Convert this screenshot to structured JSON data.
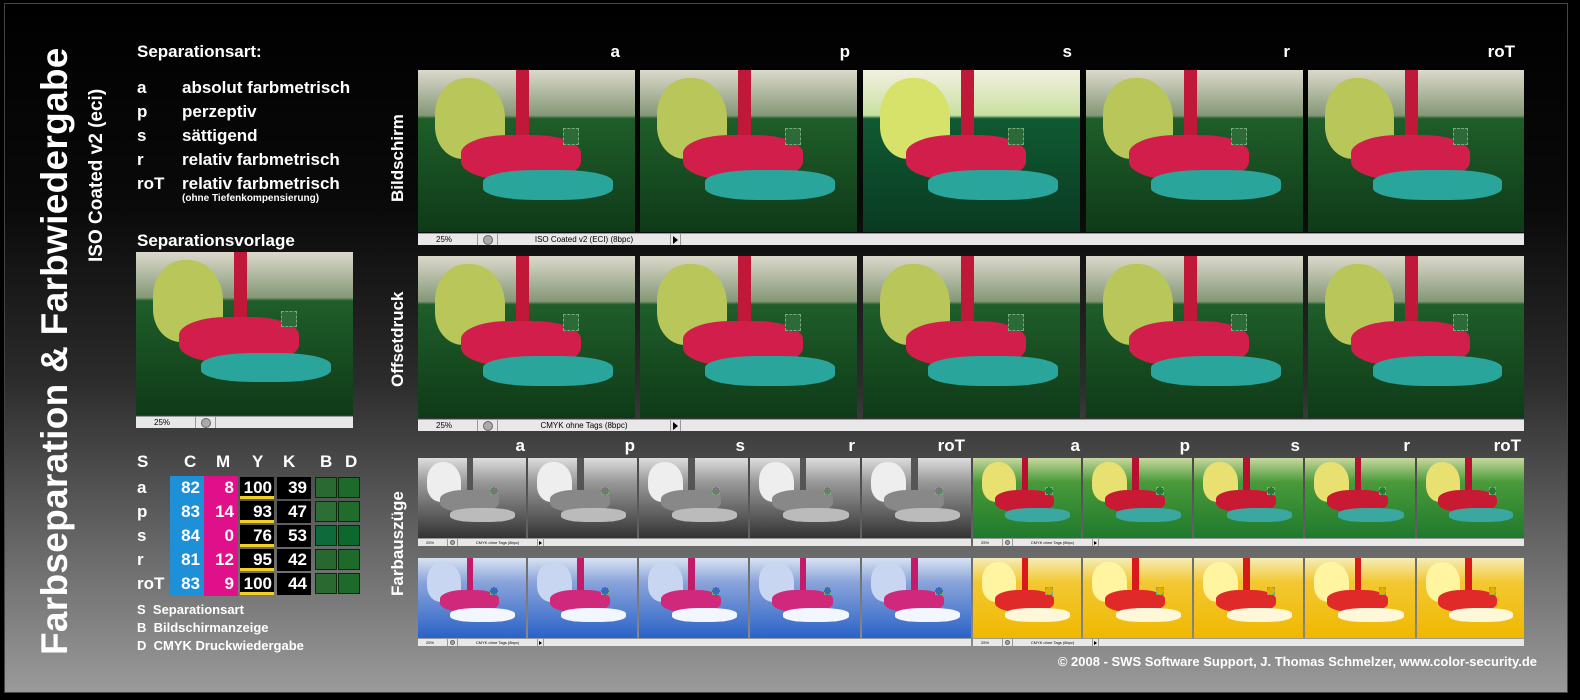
{
  "title": "Farbseparation & Farbwiedergabe",
  "subtitle": "ISO Coated v2 (eci)",
  "legend": {
    "heading": "Separationsart:",
    "items": [
      {
        "code": "a",
        "text": "absolut farbmetrisch"
      },
      {
        "code": "p",
        "text": "perzeptiv"
      },
      {
        "code": "s",
        "text": "sättigend"
      },
      {
        "code": "r",
        "text": "relativ farbmetrisch"
      },
      {
        "code": "roT",
        "text": "relativ farbmetrisch"
      }
    ],
    "note": "(ohne Tiefenkompensierung)"
  },
  "vorlage": {
    "heading": "Separationsvorlage",
    "zoom": "25%"
  },
  "columns": [
    "a",
    "p",
    "s",
    "r",
    "roT"
  ],
  "rows": {
    "bildschirm": "Bildschirm",
    "offsetdruck": "Offsetdruck",
    "farbauszuege": "Farbauszüge"
  },
  "statusbars": {
    "zoom": "25%",
    "bildschirm_profile": "ISO Coated v2 (ECI) (8bpc)",
    "offset_profile": "CMYK ohne Tags (8bpc)",
    "small_profile": "CMYK ohne Tags (8bpc)"
  },
  "table": {
    "headers": [
      "S",
      "C",
      "M",
      "Y",
      "K",
      "B",
      "D"
    ],
    "rows": [
      {
        "s": "a",
        "c": "82",
        "m": "8",
        "y": "100",
        "k": "39"
      },
      {
        "s": "p",
        "c": "83",
        "m": "14",
        "y": "93",
        "k": "47"
      },
      {
        "s": "s",
        "c": "84",
        "m": "0",
        "y": "76",
        "k": "53"
      },
      {
        "s": "r",
        "c": "81",
        "m": "12",
        "y": "95",
        "k": "42"
      },
      {
        "s": "roT",
        "c": "83",
        "m": "9",
        "y": "100",
        "k": "44"
      }
    ],
    "swatches": {
      "b": [
        "#2a6a32",
        "#2d6e36",
        "#0e6a3a",
        "#286830",
        "#2a6a30"
      ],
      "d": [
        "#1e6a2a",
        "#206c2c",
        "#0d6830",
        "#1d6a2a",
        "#1e6a2a"
      ]
    }
  },
  "footnotes": [
    {
      "code": "S",
      "text": "Separationsart"
    },
    {
      "code": "B",
      "text": "Bildschirmanzeige"
    },
    {
      "code": "D",
      "text": "CMYK Druckwiedergabe"
    }
  ],
  "copyright": "© 2008 - SWS Software Support, J. Thomas Schmelzer, www.color-security.de",
  "colors": {
    "cyan": "#1e90d8",
    "magenta": "#e0108a",
    "yellow": "#f0d020"
  }
}
